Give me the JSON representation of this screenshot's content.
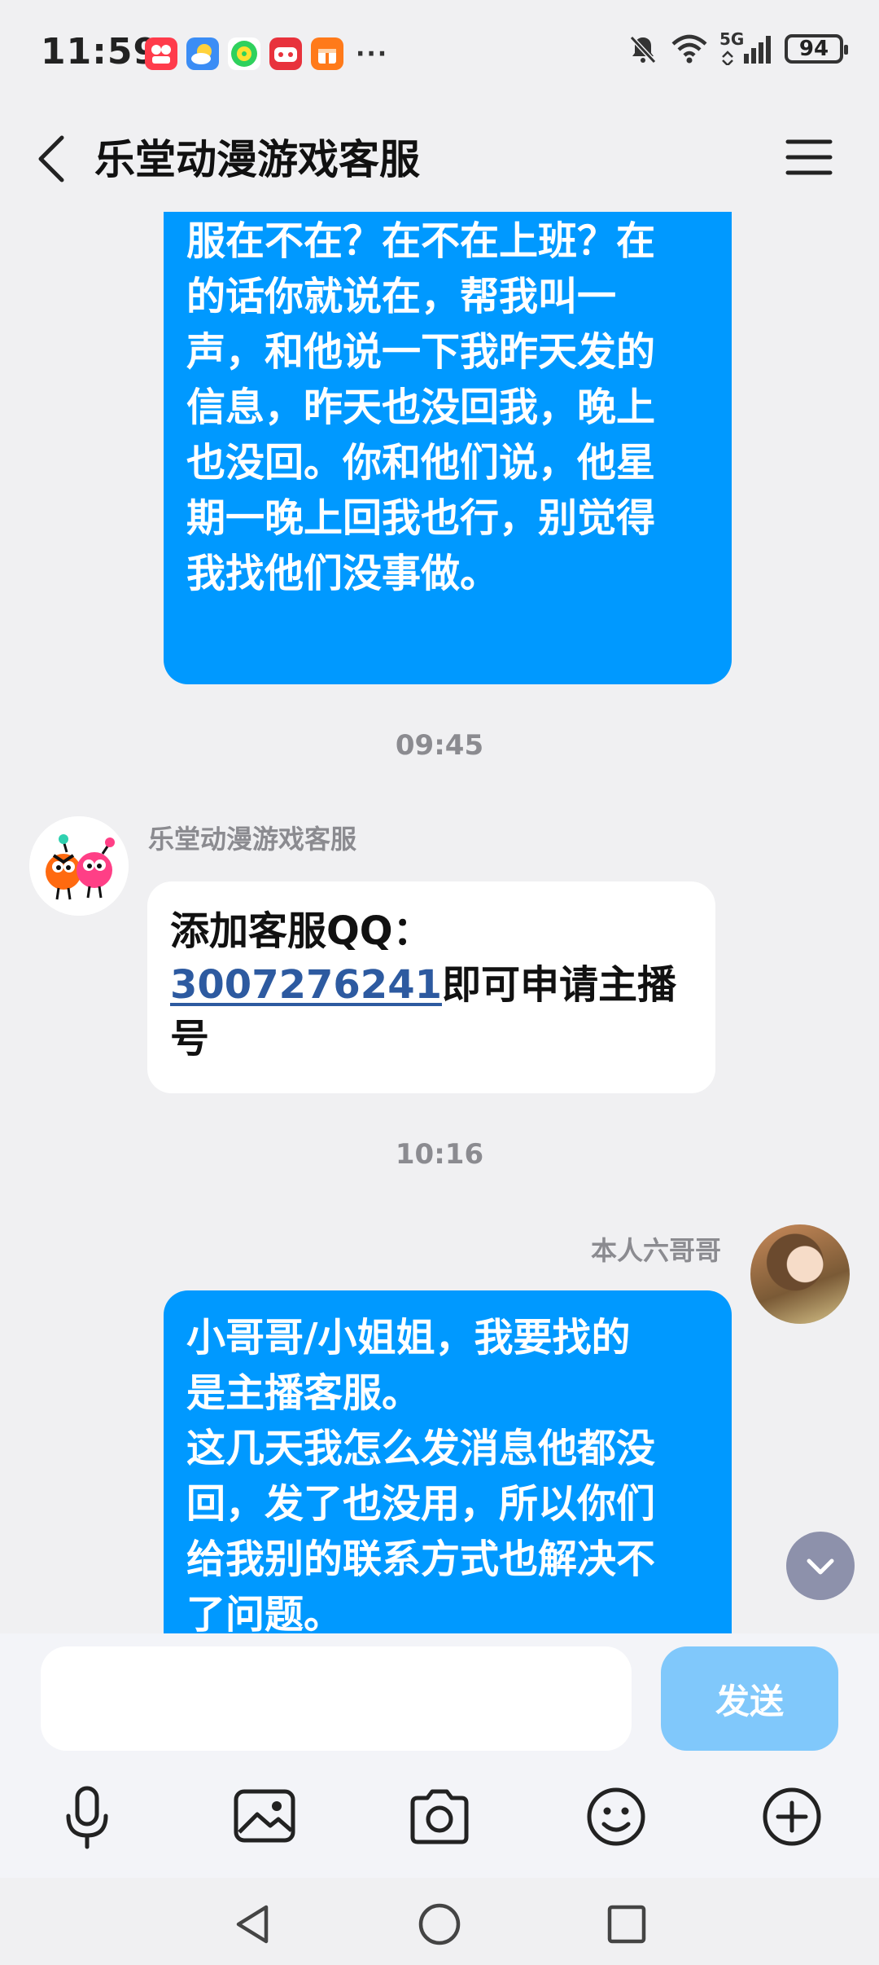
{
  "status_bar": {
    "time": "11:59",
    "network": "5G",
    "battery": "94",
    "more": "···",
    "icons": [
      "kuaishou-app-icon",
      "weather-app-icon",
      "music-app-icon",
      "game-app-icon",
      "gift-app-icon"
    ]
  },
  "header": {
    "title": "乐堂动漫游戏客服",
    "back_icon": "chevron-left-icon",
    "menu_icon": "menu-icon"
  },
  "messages": [
    {
      "id": "m1",
      "direction": "out",
      "text_lines": [
        "服在不在？在不在上班？在",
        "的话你就说在，帮我叫一",
        "声，和他说一下我昨天发的",
        "信息，昨天也没回我，晚上",
        "也没回。你和他们说，他星",
        "期一晚上回我也行，别觉得",
        "我找他们没事做。"
      ]
    },
    {
      "id": "ts1",
      "type": "timestamp",
      "text": "09:45"
    },
    {
      "id": "m2",
      "direction": "in",
      "sender": "乐堂动漫游戏客服",
      "text_prefix": "添加客服QQ：",
      "link": "3007276241",
      "text_suffix": "即可申请主播号"
    },
    {
      "id": "ts2",
      "type": "timestamp",
      "text": "10:16"
    },
    {
      "id": "m3",
      "direction": "out",
      "sender": "本人六哥哥",
      "text_lines": [
        "小哥哥/小姐姐，我要找的",
        "是主播客服。",
        "这几天我怎么发消息他都没",
        "回，发了也没用，所以你们",
        "给我别的联系方式也解决不",
        "了问题。"
      ]
    }
  ],
  "composer": {
    "input_value": "",
    "send_label": "发送"
  },
  "toolbar": [
    "microphone-icon",
    "image-icon",
    "camera-icon",
    "emoji-icon",
    "plus-icon"
  ],
  "navbar": [
    "back-triangle-icon",
    "home-circle-icon",
    "recents-square-icon"
  ],
  "colors": {
    "out_bubble": "#0099ff",
    "in_bubble": "#ffffff",
    "send_button": "#80c8fb",
    "link": "#2d5aa0",
    "background": "#f0f0f2"
  }
}
